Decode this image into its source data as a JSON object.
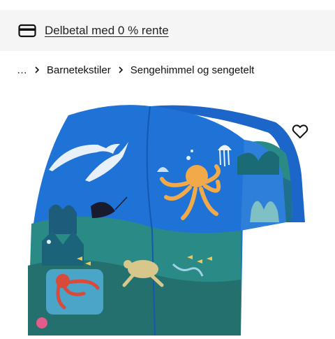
{
  "banner": {
    "icon": "credit-card-icon",
    "text": "Delbetal med 0 % rente"
  },
  "breadcrumb": {
    "items": [
      {
        "label": "…"
      },
      {
        "label": "Barnetekstiler"
      },
      {
        "label": "Sengehimmel og sengetelt"
      }
    ],
    "separator_icon": "chevron-right-icon"
  },
  "product": {
    "image": "bed-canopy-ocean-print",
    "favourite_icon": "heart-outline-icon"
  },
  "colors": {
    "banner_bg": "#f5f5f5",
    "canopy_blue": "#1f73d6",
    "ocean_teal": "#2a8a86"
  }
}
